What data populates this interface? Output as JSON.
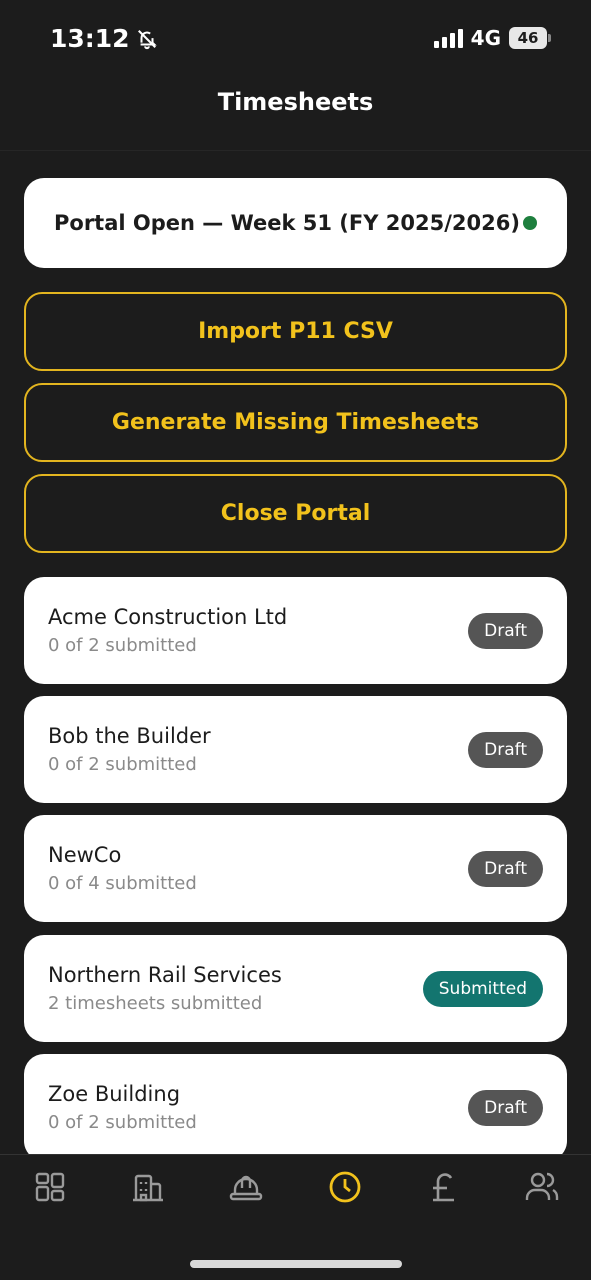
{
  "status_bar": {
    "time": "13:12",
    "network": "4G",
    "battery": "46"
  },
  "header": {
    "title": "Timesheets"
  },
  "portal": {
    "status_text": "Portal Open — Week 51 (FY 2025/2026)",
    "status_color": "#1e7f3e"
  },
  "actions": {
    "import_label": "Import P11 CSV",
    "generate_label": "Generate Missing Timesheets",
    "close_label": "Close Portal"
  },
  "companies": [
    {
      "name": "Acme Construction Ltd",
      "subtitle": "0 of 2 submitted",
      "status": "Draft"
    },
    {
      "name": "Bob the Builder",
      "subtitle": "0 of 2 submitted",
      "status": "Draft"
    },
    {
      "name": "NewCo",
      "subtitle": "0 of 4 submitted",
      "status": "Draft"
    },
    {
      "name": "Northern Rail Services",
      "subtitle": "2 timesheets submitted",
      "status": "Submitted"
    },
    {
      "name": "Zoe Building",
      "subtitle": "0 of 2 submitted",
      "status": "Draft"
    }
  ],
  "tabs": [
    {
      "icon": "dashboard-icon",
      "active": false
    },
    {
      "icon": "building-icon",
      "active": false
    },
    {
      "icon": "hard-hat-icon",
      "active": false
    },
    {
      "icon": "clock-icon",
      "active": true
    },
    {
      "icon": "pound-icon",
      "active": false
    },
    {
      "icon": "users-icon",
      "active": false
    }
  ],
  "colors": {
    "accent": "#f2c21c",
    "background": "#1c1c1c",
    "draft_badge": "#555555",
    "submitted_badge": "#13756f",
    "inactive_icon": "#9a9a9a"
  }
}
